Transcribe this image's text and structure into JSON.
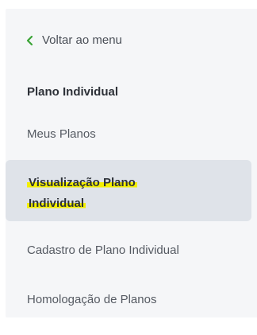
{
  "sidebar": {
    "back_label": "Voltar ao menu",
    "section_title": "Plano Individual",
    "items": [
      {
        "label": "Meus Planos",
        "active": false
      },
      {
        "label_line1": "Visualização Plano",
        "label_line2": "Individual",
        "active": true
      },
      {
        "label": "Cadastro de Plano Individual",
        "active": false
      },
      {
        "label": "Homologação de Planos",
        "active": false
      }
    ],
    "back_icon": "chevron-left-icon",
    "accent_color": "#3aa335",
    "highlight_color": "#f3ef00",
    "active_bg": "#dfe3e9",
    "panel_bg": "#f5f6f8"
  }
}
